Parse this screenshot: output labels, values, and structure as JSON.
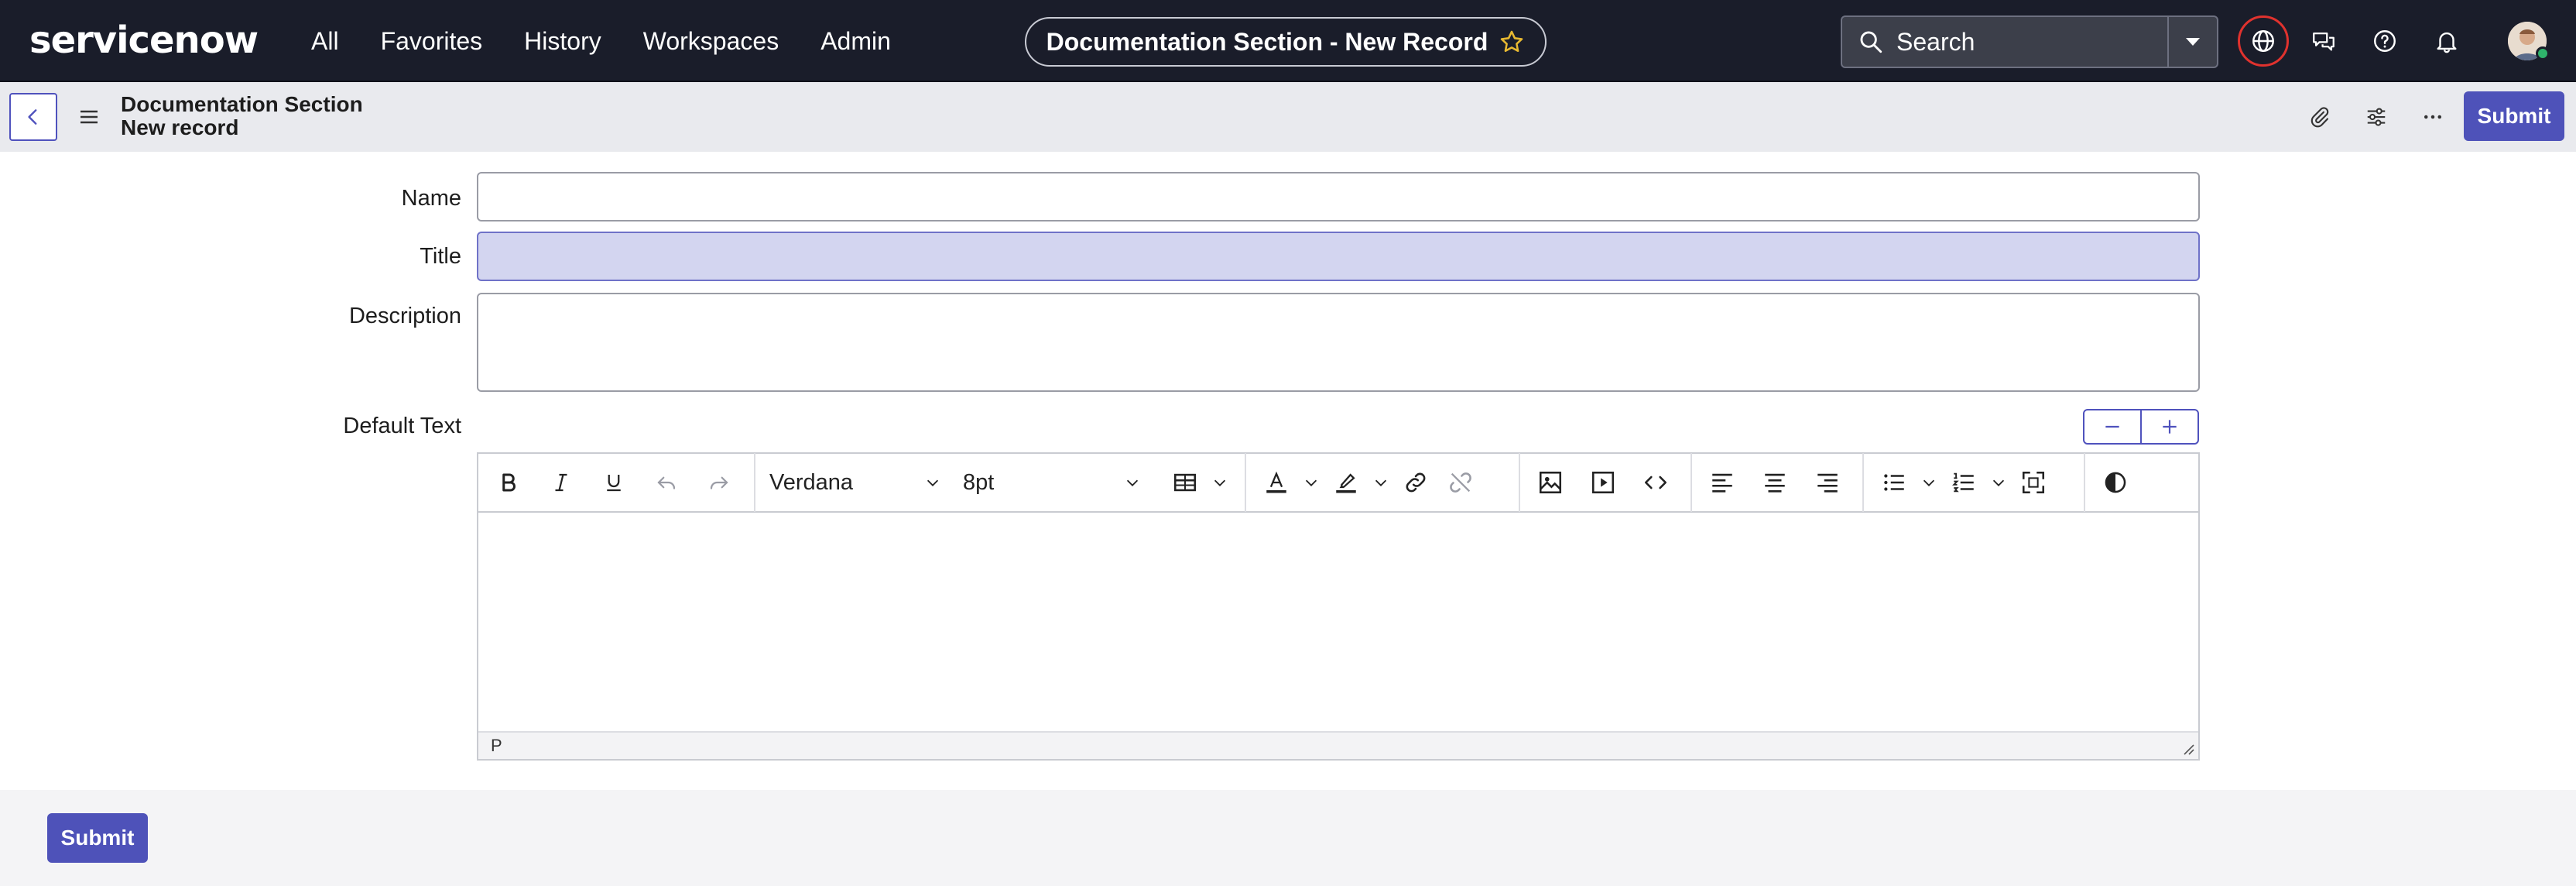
{
  "app": {
    "brand": "servicenow",
    "nav": [
      {
        "label": "All"
      },
      {
        "label": "Favorites"
      },
      {
        "label": "History"
      },
      {
        "label": "Workspaces"
      },
      {
        "label": "Admin"
      }
    ],
    "record_pill": "Documentation Section - New Record",
    "search": {
      "placeholder": "Search"
    },
    "colors": {
      "topbar": "#1a1d2a",
      "accent": "#4e52b9",
      "globe_ring": "#e0322e",
      "focused_field": "#d3d5f0"
    }
  },
  "form_header": {
    "title_line1": "Documentation Section",
    "title_line2": "New record",
    "submit_label": "Submit"
  },
  "fields": {
    "name": {
      "label": "Name",
      "value": ""
    },
    "title": {
      "label": "Title",
      "value": ""
    },
    "description": {
      "label": "Description",
      "value": ""
    },
    "default_text": {
      "label": "Default Text"
    }
  },
  "editor": {
    "font_family": "Verdana",
    "font_size": "8pt",
    "status_path": "P",
    "toolbar_icons": [
      "bold-icon",
      "italic-icon",
      "underline-icon",
      "undo-icon",
      "redo-icon",
      "table-icon",
      "text-color-icon",
      "highlight-icon",
      "link-icon",
      "unlink-icon",
      "image-icon",
      "media-icon",
      "code-icon",
      "align-left-icon",
      "align-center-icon",
      "align-right-icon",
      "bullet-list-icon",
      "numbered-list-icon",
      "fullscreen-icon",
      "contrast-icon"
    ]
  },
  "footer": {
    "submit_label": "Submit"
  }
}
